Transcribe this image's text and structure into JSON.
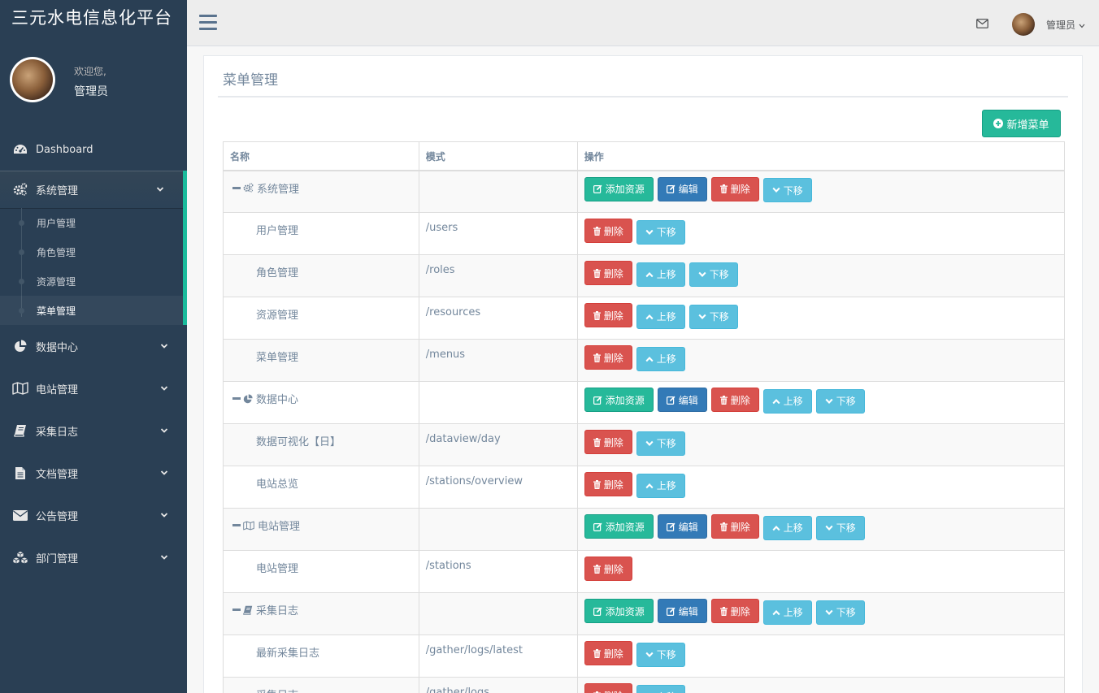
{
  "brand": "三元水电信息化平台",
  "profile": {
    "welcome": "欢迎您,",
    "name": "管理员"
  },
  "sidebar": {
    "items": [
      {
        "label": "Dashboard",
        "icon": "dashboard-icon"
      },
      {
        "label": "系统管理",
        "icon": "cogs-icon",
        "expanded": true,
        "children": [
          "用户管理",
          "角色管理",
          "资源管理",
          "菜单管理"
        ],
        "current_child": "菜单管理"
      },
      {
        "label": "数据中心",
        "icon": "pie-chart-icon"
      },
      {
        "label": "电站管理",
        "icon": "map-icon"
      },
      {
        "label": "采集日志",
        "icon": "book-icon"
      },
      {
        "label": "文档管理",
        "icon": "file-icon"
      },
      {
        "label": "公告管理",
        "icon": "envelope-icon"
      },
      {
        "label": "部门管理",
        "icon": "cubes-icon"
      }
    ]
  },
  "topnav": {
    "user": "管理员"
  },
  "panel": {
    "title": "菜单管理",
    "add_button": "新增菜单",
    "columns": [
      "名称",
      "模式",
      "操作"
    ]
  },
  "buttons": {
    "add_resource": "添加资源",
    "edit": "编辑",
    "delete": "删除",
    "up": "上移",
    "down": "下移"
  },
  "rows": [
    {
      "name": "系统管理",
      "type": "group",
      "icon": "cogs-icon",
      "pattern": "",
      "actions": [
        "add_resource",
        "edit",
        "delete",
        "down"
      ]
    },
    {
      "name": "用户管理",
      "type": "child",
      "pattern": "/users",
      "actions": [
        "delete",
        "down"
      ]
    },
    {
      "name": "角色管理",
      "type": "child",
      "pattern": "/roles",
      "actions": [
        "delete",
        "up",
        "down"
      ]
    },
    {
      "name": "资源管理",
      "type": "child",
      "pattern": "/resources",
      "actions": [
        "delete",
        "up",
        "down"
      ]
    },
    {
      "name": "菜单管理",
      "type": "child",
      "pattern": "/menus",
      "actions": [
        "delete",
        "up"
      ]
    },
    {
      "name": "数据中心",
      "type": "group",
      "icon": "pie-chart-icon",
      "pattern": "",
      "actions": [
        "add_resource",
        "edit",
        "delete",
        "up",
        "down"
      ]
    },
    {
      "name": "数据可视化【日】",
      "type": "child",
      "pattern": "/dataview/day",
      "actions": [
        "delete",
        "down"
      ]
    },
    {
      "name": "电站总览",
      "type": "child",
      "pattern": "/stations/overview",
      "actions": [
        "delete",
        "up"
      ]
    },
    {
      "name": "电站管理",
      "type": "group",
      "icon": "map-icon",
      "pattern": "",
      "actions": [
        "add_resource",
        "edit",
        "delete",
        "up",
        "down"
      ]
    },
    {
      "name": "电站管理",
      "type": "child",
      "pattern": "/stations",
      "actions": [
        "delete"
      ]
    },
    {
      "name": "采集日志",
      "type": "group",
      "icon": "book-icon",
      "pattern": "",
      "actions": [
        "add_resource",
        "edit",
        "delete",
        "up",
        "down"
      ]
    },
    {
      "name": "最新采集日志",
      "type": "child",
      "pattern": "/gather/logs/latest",
      "actions": [
        "delete",
        "down"
      ]
    },
    {
      "name": "采集日志",
      "type": "child",
      "pattern": "/gather/logs",
      "actions": [
        "delete",
        "up"
      ]
    }
  ]
}
